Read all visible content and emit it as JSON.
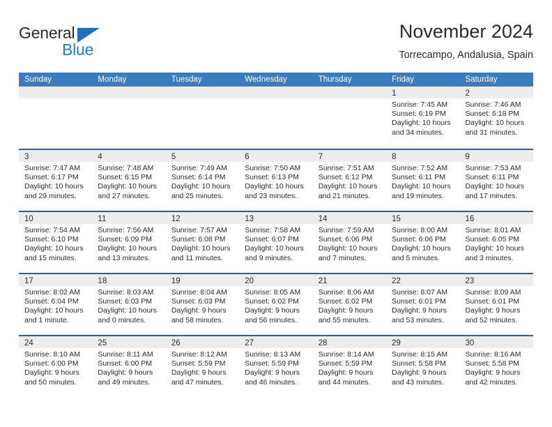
{
  "brand": {
    "name_part1": "General",
    "name_part2": "Blue",
    "triangle_color": "#1f6fc0",
    "blue_color": "#1f7fd0"
  },
  "header": {
    "title": "November 2024",
    "subtitle": "Torrecampo, Andalusia, Spain"
  },
  "colors": {
    "header_blue": "#3a7cc0",
    "row_separator": "#2e5f93",
    "day_strip_gray": "#ededed",
    "text": "#2b2b2b"
  },
  "weekdays": [
    "Sunday",
    "Monday",
    "Tuesday",
    "Wednesday",
    "Thursday",
    "Friday",
    "Saturday"
  ],
  "weeks": [
    [
      {
        "day": "",
        "sunrise": "",
        "sunset": "",
        "daylight": "",
        "empty": true
      },
      {
        "day": "",
        "sunrise": "",
        "sunset": "",
        "daylight": "",
        "empty": true
      },
      {
        "day": "",
        "sunrise": "",
        "sunset": "",
        "daylight": "",
        "empty": true
      },
      {
        "day": "",
        "sunrise": "",
        "sunset": "",
        "daylight": "",
        "empty": true
      },
      {
        "day": "",
        "sunrise": "",
        "sunset": "",
        "daylight": "",
        "empty": true
      },
      {
        "day": "1",
        "sunrise": "Sunrise: 7:45 AM",
        "sunset": "Sunset: 6:19 PM",
        "daylight": "Daylight: 10 hours and 34 minutes.",
        "empty": false
      },
      {
        "day": "2",
        "sunrise": "Sunrise: 7:46 AM",
        "sunset": "Sunset: 6:18 PM",
        "daylight": "Daylight: 10 hours and 31 minutes.",
        "empty": false
      }
    ],
    [
      {
        "day": "3",
        "sunrise": "Sunrise: 7:47 AM",
        "sunset": "Sunset: 6:17 PM",
        "daylight": "Daylight: 10 hours and 29 minutes.",
        "empty": false
      },
      {
        "day": "4",
        "sunrise": "Sunrise: 7:48 AM",
        "sunset": "Sunset: 6:15 PM",
        "daylight": "Daylight: 10 hours and 27 minutes.",
        "empty": false
      },
      {
        "day": "5",
        "sunrise": "Sunrise: 7:49 AM",
        "sunset": "Sunset: 6:14 PM",
        "daylight": "Daylight: 10 hours and 25 minutes.",
        "empty": false
      },
      {
        "day": "6",
        "sunrise": "Sunrise: 7:50 AM",
        "sunset": "Sunset: 6:13 PM",
        "daylight": "Daylight: 10 hours and 23 minutes.",
        "empty": false
      },
      {
        "day": "7",
        "sunrise": "Sunrise: 7:51 AM",
        "sunset": "Sunset: 6:12 PM",
        "daylight": "Daylight: 10 hours and 21 minutes.",
        "empty": false
      },
      {
        "day": "8",
        "sunrise": "Sunrise: 7:52 AM",
        "sunset": "Sunset: 6:11 PM",
        "daylight": "Daylight: 10 hours and 19 minutes.",
        "empty": false
      },
      {
        "day": "9",
        "sunrise": "Sunrise: 7:53 AM",
        "sunset": "Sunset: 6:11 PM",
        "daylight": "Daylight: 10 hours and 17 minutes.",
        "empty": false
      }
    ],
    [
      {
        "day": "10",
        "sunrise": "Sunrise: 7:54 AM",
        "sunset": "Sunset: 6:10 PM",
        "daylight": "Daylight: 10 hours and 15 minutes.",
        "empty": false
      },
      {
        "day": "11",
        "sunrise": "Sunrise: 7:56 AM",
        "sunset": "Sunset: 6:09 PM",
        "daylight": "Daylight: 10 hours and 13 minutes.",
        "empty": false
      },
      {
        "day": "12",
        "sunrise": "Sunrise: 7:57 AM",
        "sunset": "Sunset: 6:08 PM",
        "daylight": "Daylight: 10 hours and 11 minutes.",
        "empty": false
      },
      {
        "day": "13",
        "sunrise": "Sunrise: 7:58 AM",
        "sunset": "Sunset: 6:07 PM",
        "daylight": "Daylight: 10 hours and 9 minutes.",
        "empty": false
      },
      {
        "day": "14",
        "sunrise": "Sunrise: 7:59 AM",
        "sunset": "Sunset: 6:06 PM",
        "daylight": "Daylight: 10 hours and 7 minutes.",
        "empty": false
      },
      {
        "day": "15",
        "sunrise": "Sunrise: 8:00 AM",
        "sunset": "Sunset: 6:06 PM",
        "daylight": "Daylight: 10 hours and 5 minutes.",
        "empty": false
      },
      {
        "day": "16",
        "sunrise": "Sunrise: 8:01 AM",
        "sunset": "Sunset: 6:05 PM",
        "daylight": "Daylight: 10 hours and 3 minutes.",
        "empty": false
      }
    ],
    [
      {
        "day": "17",
        "sunrise": "Sunrise: 8:02 AM",
        "sunset": "Sunset: 6:04 PM",
        "daylight": "Daylight: 10 hours and 1 minute.",
        "empty": false
      },
      {
        "day": "18",
        "sunrise": "Sunrise: 8:03 AM",
        "sunset": "Sunset: 6:03 PM",
        "daylight": "Daylight: 10 hours and 0 minutes.",
        "empty": false
      },
      {
        "day": "19",
        "sunrise": "Sunrise: 8:04 AM",
        "sunset": "Sunset: 6:03 PM",
        "daylight": "Daylight: 9 hours and 58 minutes.",
        "empty": false
      },
      {
        "day": "20",
        "sunrise": "Sunrise: 8:05 AM",
        "sunset": "Sunset: 6:02 PM",
        "daylight": "Daylight: 9 hours and 56 minutes.",
        "empty": false
      },
      {
        "day": "21",
        "sunrise": "Sunrise: 8:06 AM",
        "sunset": "Sunset: 6:02 PM",
        "daylight": "Daylight: 9 hours and 55 minutes.",
        "empty": false
      },
      {
        "day": "22",
        "sunrise": "Sunrise: 8:07 AM",
        "sunset": "Sunset: 6:01 PM",
        "daylight": "Daylight: 9 hours and 53 minutes.",
        "empty": false
      },
      {
        "day": "23",
        "sunrise": "Sunrise: 8:09 AM",
        "sunset": "Sunset: 6:01 PM",
        "daylight": "Daylight: 9 hours and 52 minutes.",
        "empty": false
      }
    ],
    [
      {
        "day": "24",
        "sunrise": "Sunrise: 8:10 AM",
        "sunset": "Sunset: 6:00 PM",
        "daylight": "Daylight: 9 hours and 50 minutes.",
        "empty": false
      },
      {
        "day": "25",
        "sunrise": "Sunrise: 8:11 AM",
        "sunset": "Sunset: 6:00 PM",
        "daylight": "Daylight: 9 hours and 49 minutes.",
        "empty": false
      },
      {
        "day": "26",
        "sunrise": "Sunrise: 8:12 AM",
        "sunset": "Sunset: 5:59 PM",
        "daylight": "Daylight: 9 hours and 47 minutes.",
        "empty": false
      },
      {
        "day": "27",
        "sunrise": "Sunrise: 8:13 AM",
        "sunset": "Sunset: 5:59 PM",
        "daylight": "Daylight: 9 hours and 46 minutes.",
        "empty": false
      },
      {
        "day": "28",
        "sunrise": "Sunrise: 8:14 AM",
        "sunset": "Sunset: 5:59 PM",
        "daylight": "Daylight: 9 hours and 44 minutes.",
        "empty": false
      },
      {
        "day": "29",
        "sunrise": "Sunrise: 8:15 AM",
        "sunset": "Sunset: 5:58 PM",
        "daylight": "Daylight: 9 hours and 43 minutes.",
        "empty": false
      },
      {
        "day": "30",
        "sunrise": "Sunrise: 8:16 AM",
        "sunset": "Sunset: 5:58 PM",
        "daylight": "Daylight: 9 hours and 42 minutes.",
        "empty": false
      }
    ]
  ]
}
